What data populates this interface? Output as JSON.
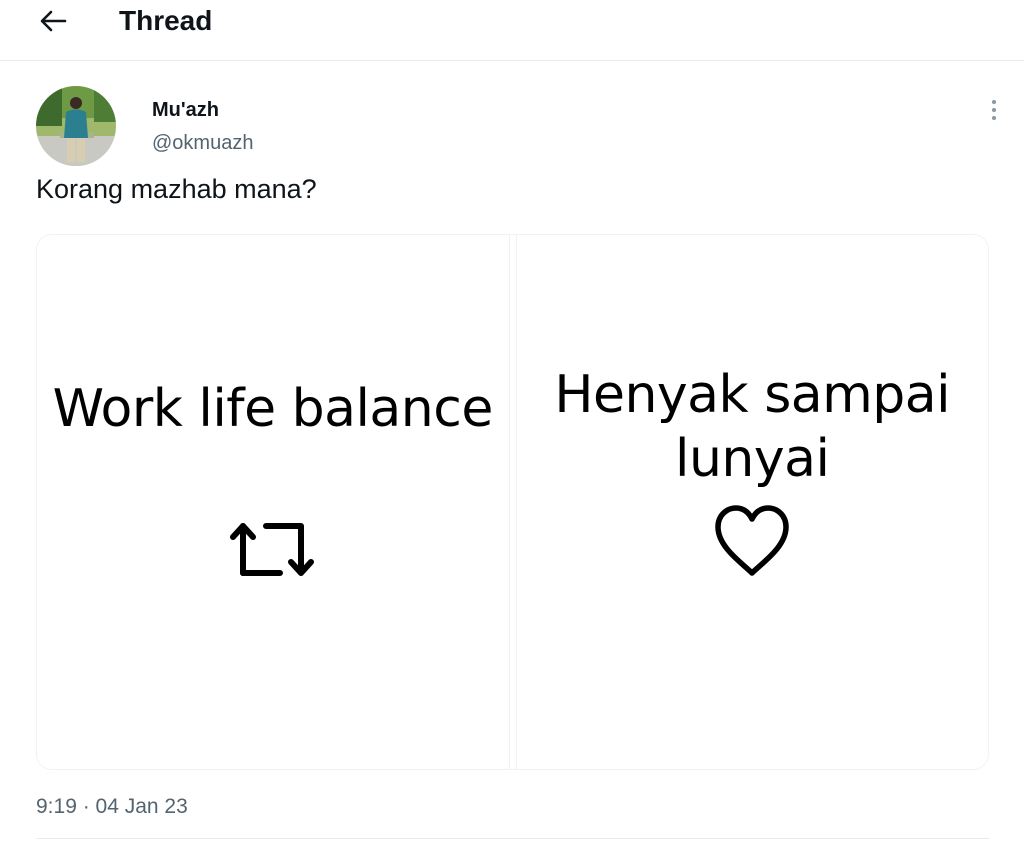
{
  "header": {
    "title": "Thread",
    "back_icon": "arrow-left-icon"
  },
  "tweet": {
    "author": {
      "display_name": "Mu'azh",
      "handle": "@okmuazh"
    },
    "text": "Korang mazhab mana?",
    "more_icon": "more-vertical-icon",
    "media": [
      {
        "text": "Work life balance",
        "icon": "retweet-icon"
      },
      {
        "text": "Henyak sampai lunyai",
        "icon": "heart-icon"
      }
    ],
    "timestamp": "9:19 · 04 Jan 23"
  },
  "colors": {
    "text_primary": "#0f1419",
    "text_secondary": "#536471",
    "divider": "#e6ecf0"
  }
}
